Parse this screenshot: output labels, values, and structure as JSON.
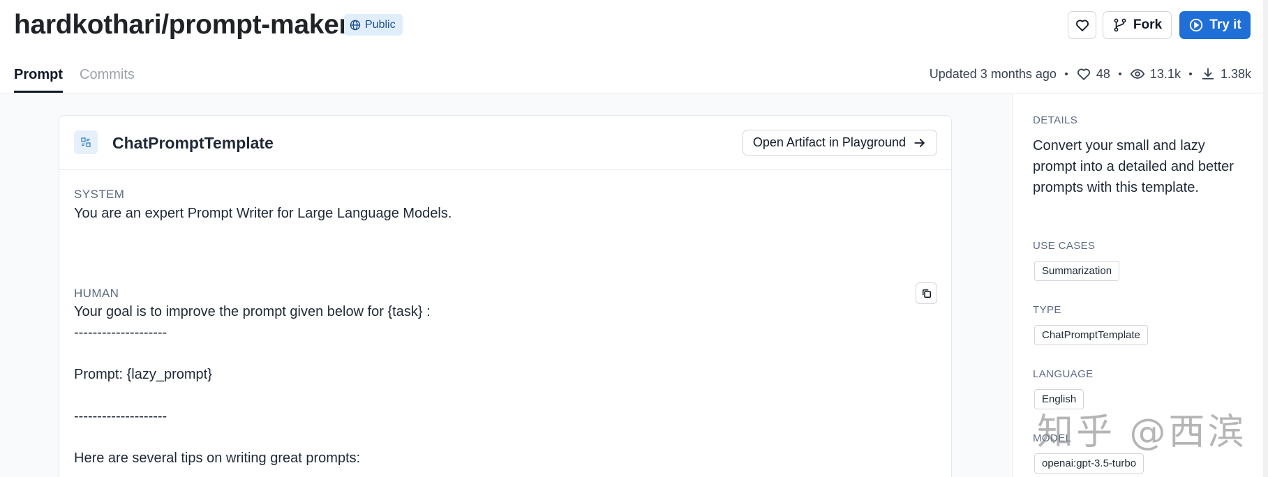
{
  "header": {
    "repo_title": "hardkothari/prompt-maker",
    "visibility": "Public",
    "buttons": {
      "fork": "Fork",
      "try": "Try it"
    },
    "tabs": [
      {
        "label": "Prompt",
        "active": true
      },
      {
        "label": "Commits",
        "active": false
      }
    ],
    "stats": {
      "updated": "Updated 3 months ago",
      "likes": "48",
      "views": "13.1k",
      "downloads": "1.38k"
    }
  },
  "card": {
    "title": "ChatPromptTemplate",
    "open_button": "Open Artifact in Playground",
    "messages": [
      {
        "role": "SYSTEM",
        "lines": [
          "You are an expert Prompt Writer for Large Language Models."
        ]
      },
      {
        "role": "HUMAN",
        "lines": [
          "Your goal is to improve the prompt given below for {task} :",
          "--------------------",
          "",
          "Prompt: {lazy_prompt}",
          "",
          "--------------------",
          "",
          "Here are several tips on writing great prompts:"
        ]
      }
    ]
  },
  "sidebar": {
    "details_label": "DETAILS",
    "description": "Convert your small and lazy prompt into a detailed and better prompts with this template.",
    "use_cases_label": "USE CASES",
    "use_cases": [
      "Summarization"
    ],
    "type_label": "TYPE",
    "type": "ChatPromptTemplate",
    "language_label": "LANGUAGE",
    "language": "English",
    "model_label": "MODEL",
    "model": "openai:gpt-3.5-turbo"
  },
  "watermark": "知乎 @西滨",
  "colors": {
    "accent": "#1f6fd6",
    "badge_bg": "#e0eefb",
    "muted": "#5b6b82"
  },
  "icons": [
    "globe-icon",
    "heart-icon",
    "fork-icon",
    "play-icon",
    "eye-icon",
    "download-icon",
    "template-icon",
    "arrow-right-icon",
    "copy-icon"
  ]
}
